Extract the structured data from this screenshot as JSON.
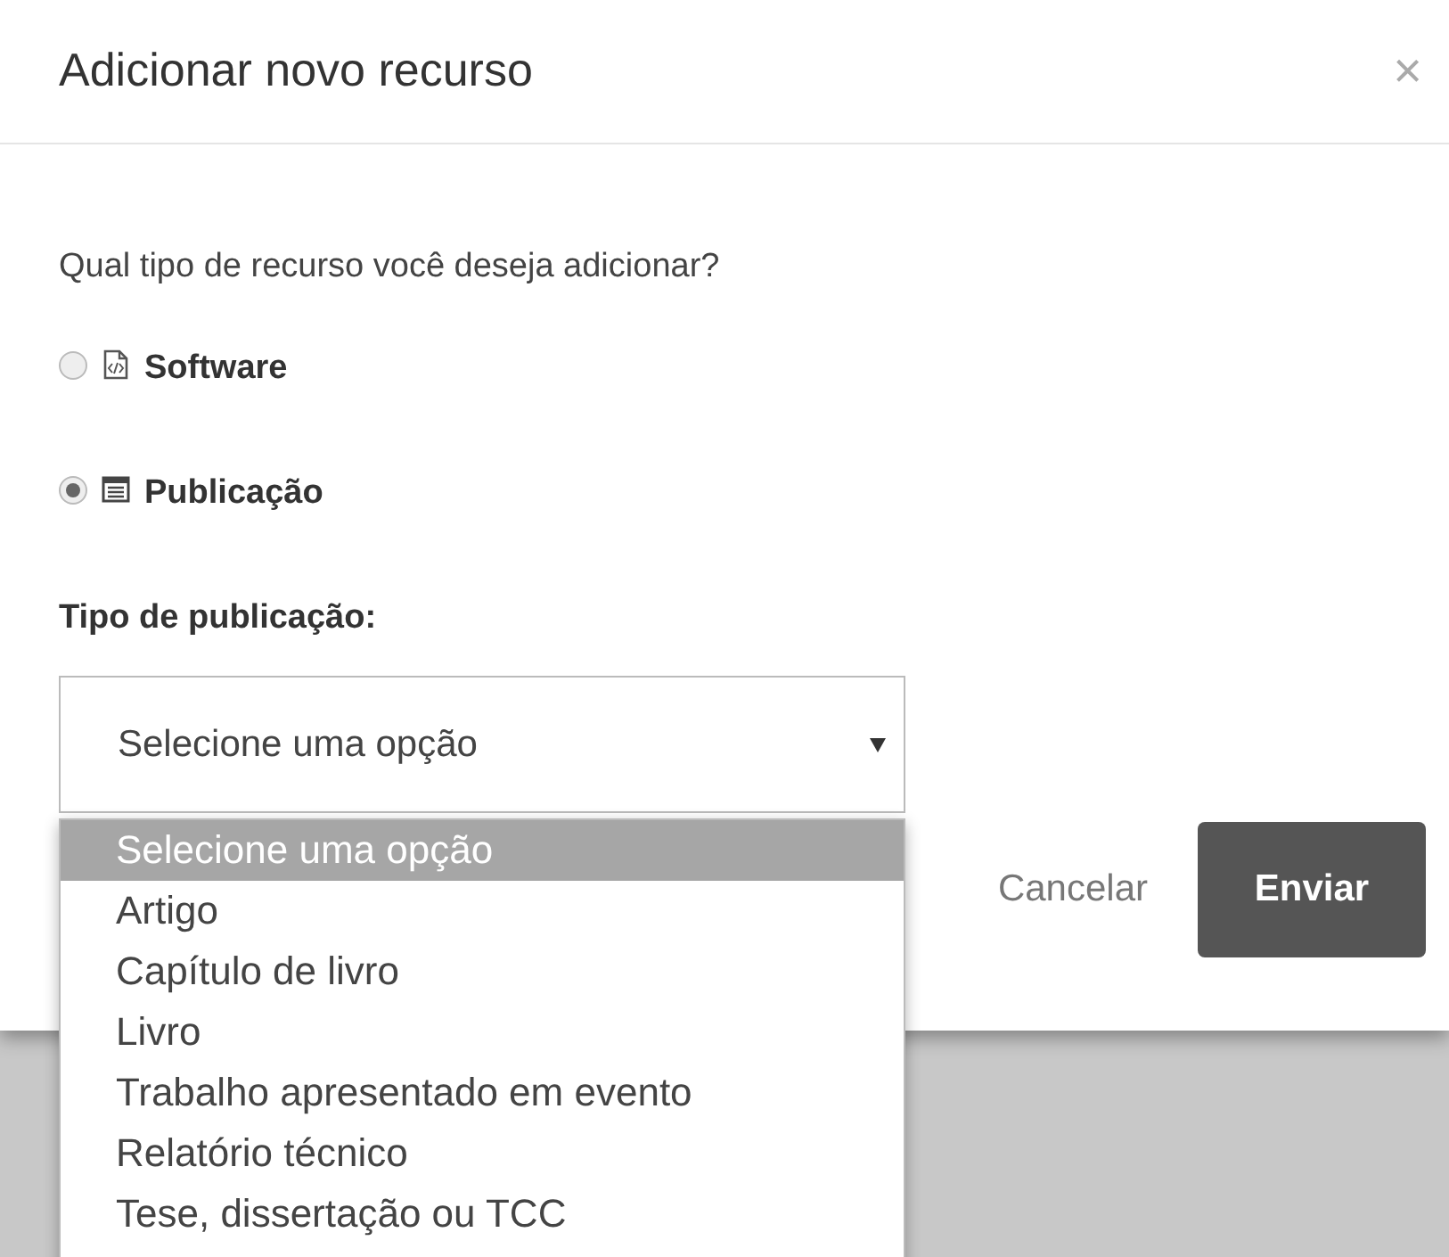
{
  "dialog": {
    "title": "Adicionar novo recurso",
    "close": "×"
  },
  "question": "Qual tipo de recurso você deseja adicionar?",
  "resource_types": [
    {
      "label": "Software",
      "kind": "software",
      "selected": false
    },
    {
      "label": "Publicação",
      "kind": "publication",
      "selected": true
    }
  ],
  "publication_type": {
    "label": "Tipo de publicação:",
    "value": "Selecione uma opção",
    "expanded": true,
    "options": [
      {
        "label": "Selecione uma opção",
        "selected": true
      },
      {
        "label": "Artigo",
        "selected": false
      },
      {
        "label": "Capítulo de livro",
        "selected": false
      },
      {
        "label": "Livro",
        "selected": false
      },
      {
        "label": "Trabalho apresentado em evento",
        "selected": false
      },
      {
        "label": "Relatório técnico",
        "selected": false
      },
      {
        "label": "Tese, dissertação ou TCC",
        "selected": false
      }
    ]
  },
  "buttons": [
    {
      "label": "Cancelar",
      "kind": "link"
    },
    {
      "label": "Enviar",
      "kind": "primary"
    }
  ]
}
